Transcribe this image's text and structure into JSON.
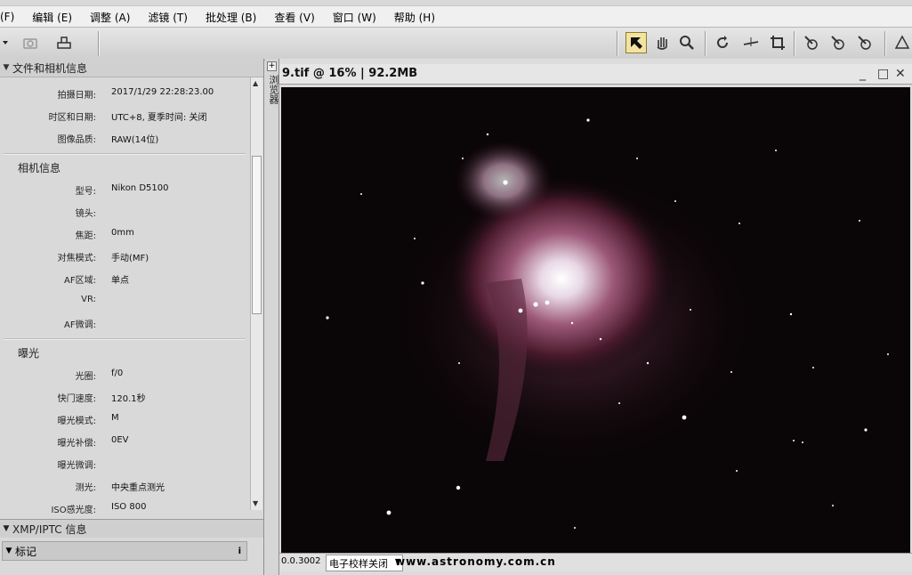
{
  "menu": [
    "(F)",
    "编辑 (E)",
    "调整 (A)",
    "滤镜 (T)",
    "批处理 (B)",
    "查看 (V)",
    "窗口 (W)",
    "帮助 (H)"
  ],
  "panel": {
    "section1_title": "文件和相机信息",
    "file_rows": [
      {
        "k": "拍摄日期:",
        "v": "2017/1/29 22:28:23.00"
      },
      {
        "k": "时区和日期:",
        "v": "UTC+8, 夏季时间: 关闭"
      },
      {
        "k": "图像品质:",
        "v": "RAW(14位)"
      }
    ],
    "camera_title": "相机信息",
    "camera_rows": [
      {
        "k": "型号:",
        "v": "Nikon D5100"
      },
      {
        "k": "镜头:",
        "v": ""
      },
      {
        "k": "焦距:",
        "v": "0mm"
      },
      {
        "k": "对焦模式:",
        "v": "手动(MF)"
      },
      {
        "k": "AF区域:",
        "v": "单点"
      },
      {
        "k": "VR:",
        "v": ""
      },
      {
        "k": "AF微调:",
        "v": ""
      }
    ],
    "exposure_title": "曝光",
    "exposure_rows": [
      {
        "k": "光圈:",
        "v": "f/0"
      },
      {
        "k": "快门速度:",
        "v": "120.1秒"
      },
      {
        "k": "曝光模式:",
        "v": "M"
      },
      {
        "k": "曝光补偿:",
        "v": "0EV"
      },
      {
        "k": "曝光微调:",
        "v": ""
      },
      {
        "k": "测光:",
        "v": "中央重点测光"
      },
      {
        "k": "ISO感光度:",
        "v": "ISO 800"
      }
    ],
    "section2_title": "XMP/IPTC 信息",
    "sub_title": "标记"
  },
  "side_tab": "浏览器",
  "image_window": {
    "title": "9.tif @ 16% | 92.2MB",
    "zoom": "0.0.3002",
    "proof": "电子校样关闭",
    "watermark": "www.astronomy.com.cn"
  },
  "colors": {
    "nebula": "#b07090",
    "core": "#f4eef4",
    "sky": "#0a0507"
  }
}
